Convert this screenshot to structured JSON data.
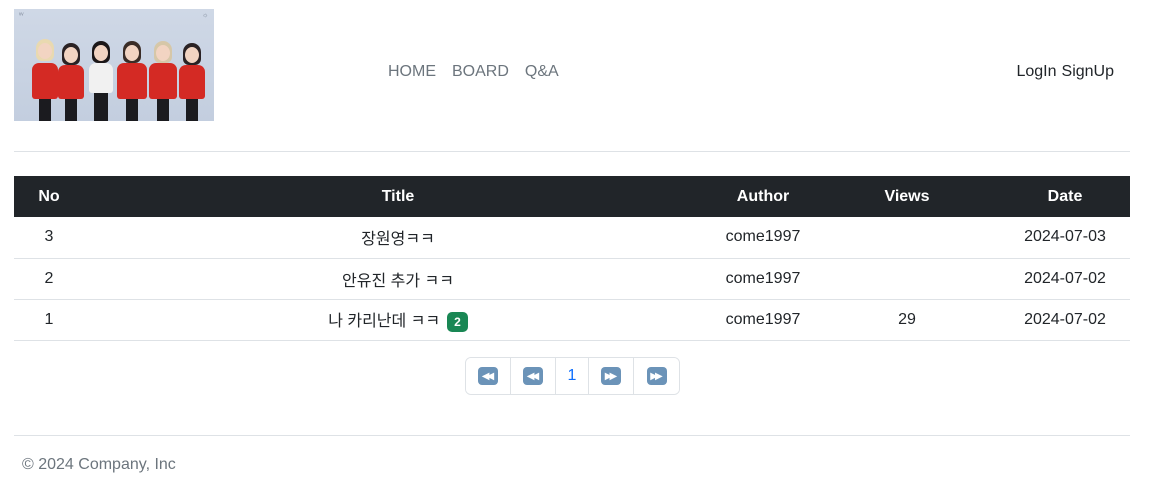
{
  "header": {
    "nav": [
      {
        "label": "HOME"
      },
      {
        "label": "BOARD"
      },
      {
        "label": "Q&A"
      }
    ],
    "auth": {
      "login_label": "LogIn",
      "signup_label": "SignUp"
    }
  },
  "table": {
    "columns": [
      "No",
      "Title",
      "Author",
      "Views",
      "Date"
    ],
    "rows": [
      {
        "no": "3",
        "title": "장원영ㅋㅋ",
        "author": "come1997",
        "views": "",
        "date": "2024-07-03",
        "comments": ""
      },
      {
        "no": "2",
        "title": "안유진 추가 ㅋㅋ",
        "author": "come1997",
        "views": "",
        "date": "2024-07-02",
        "comments": ""
      },
      {
        "no": "1",
        "title": "나 카리난데 ㅋㅋ",
        "author": "come1997",
        "views": "29",
        "date": "2024-07-02",
        "comments": "2"
      }
    ]
  },
  "pagination": {
    "first_icon": "first-page-icon",
    "prev_icon": "previous-page-icon",
    "current_page": "1",
    "next_icon": "next-page-icon",
    "last_icon": "last-page-icon",
    "icon_color": "#6b93b8"
  },
  "footer": {
    "copyright": "© 2024 Company, Inc"
  },
  "colors": {
    "table_header_bg": "#212529",
    "badge_bg": "#198754",
    "link": "#0d6efd"
  }
}
